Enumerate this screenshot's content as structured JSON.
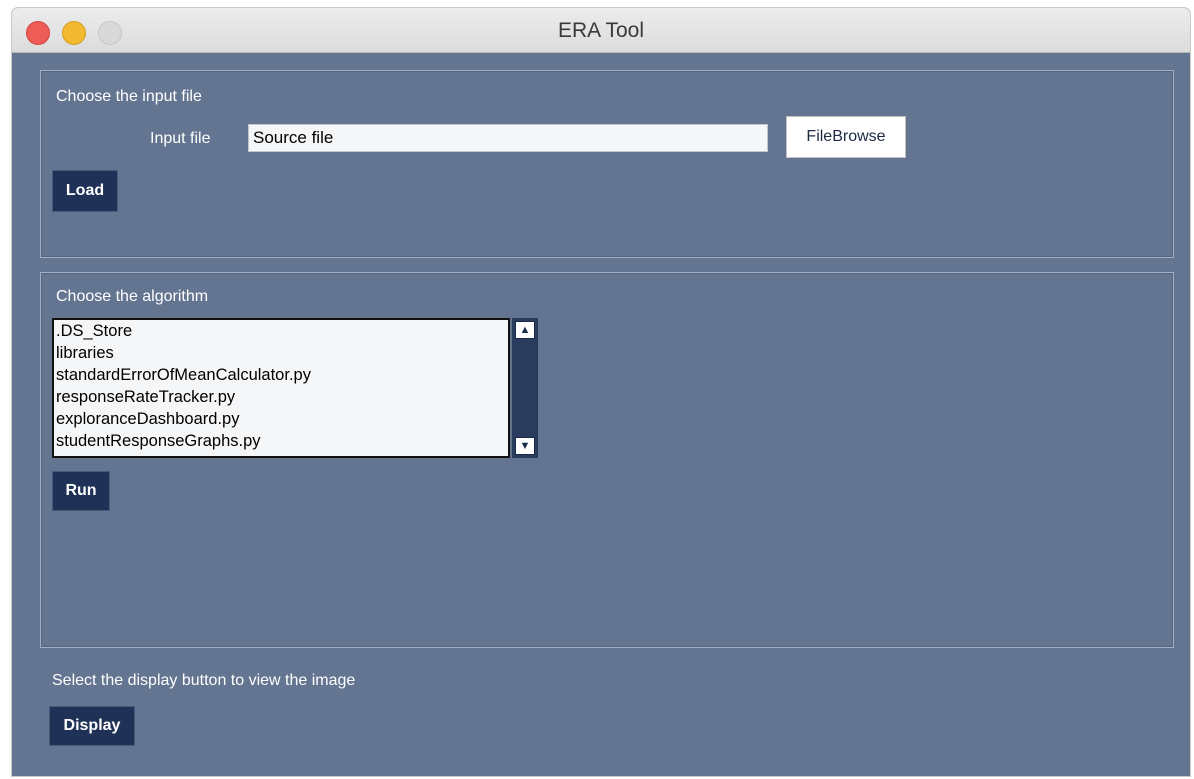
{
  "window": {
    "title": "ERA Tool"
  },
  "input_section": {
    "heading": "Choose the input file",
    "input_label": "Input file",
    "input_value": "Source file",
    "browse_button": "FileBrowse",
    "load_button": "Load"
  },
  "algorithm_section": {
    "heading": "Choose the algorithm",
    "items": [
      ".DS_Store",
      "libraries",
      "standardErrorOfMeanCalculator.py",
      "responseRateTracker.py",
      "exploranceDashboard.py",
      "studentResponseGraphs.py"
    ],
    "scroll_up_icon": "arrow-up-icon",
    "scroll_down_icon": "arrow-down-icon",
    "run_button": "Run"
  },
  "display_section": {
    "instruction": "Select the display button to view the image",
    "display_button": "Display"
  }
}
